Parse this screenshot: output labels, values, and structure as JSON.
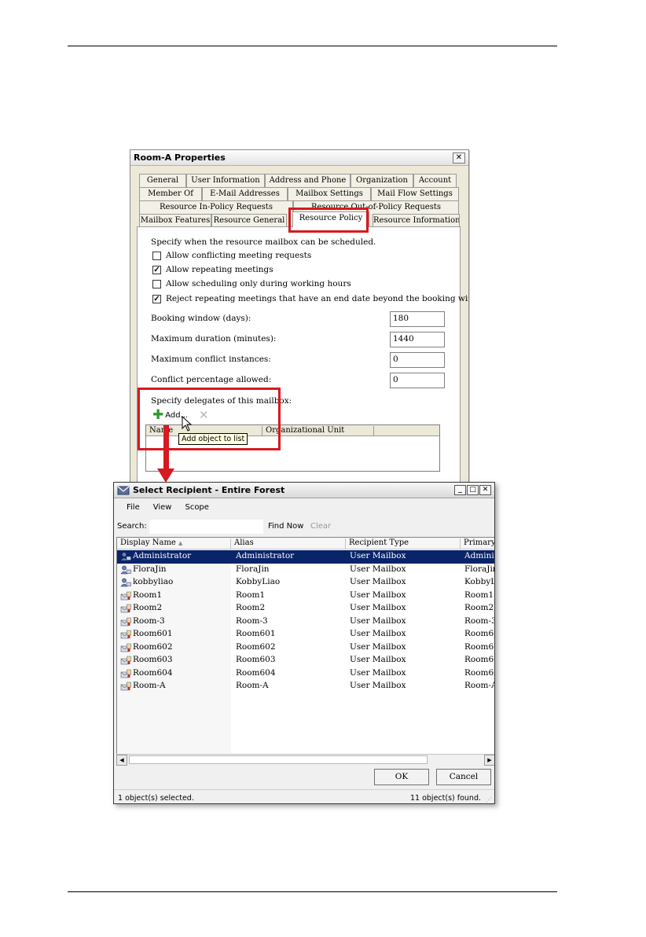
{
  "props": {
    "title": "Room-A Properties",
    "close": "✕",
    "tabs": {
      "row1": [
        "General",
        "User Information",
        "Address and Phone",
        "Organization",
        "Account"
      ],
      "row2": [
        "Member Of",
        "E-Mail Addresses",
        "Mailbox Settings",
        "Mail Flow Settings"
      ],
      "row3": [
        "Resource In-Policy Requests",
        "Resource Out-of-Policy Requests"
      ],
      "row4": [
        "Mailbox Features",
        "Resource General",
        "Resource Policy",
        "Resource Information"
      ],
      "active": "Resource Policy"
    },
    "schedule_heading": "Specify when the resource mailbox can be scheduled.",
    "checks": [
      {
        "label": "Allow conflicting meeting requests",
        "checked": false,
        "mark": ""
      },
      {
        "label": "Allow repeating meetings",
        "checked": true,
        "mark": "✓"
      },
      {
        "label": "Allow scheduling only during working hours",
        "checked": false,
        "mark": ""
      },
      {
        "label": "Reject repeating meetings that have an end date beyond the booking window",
        "checked": true,
        "mark": "✓"
      }
    ],
    "fields": [
      {
        "label": "Booking window (days):",
        "value": "180"
      },
      {
        "label": "Maximum duration (minutes):",
        "value": "1440"
      },
      {
        "label": "Maximum conflict instances:",
        "value": "0"
      },
      {
        "label": "Conflict percentage allowed:",
        "value": "0"
      }
    ],
    "delegates_heading": "Specify delegates of this mailbox:",
    "add_label": "Add...",
    "remove_icon": "✕",
    "delegate_columns": [
      "Name",
      "Organizational Unit"
    ],
    "tooltip": "Add object to list"
  },
  "select": {
    "title": "Select Recipient - Entire Forest",
    "window_buttons": [
      "_",
      "□",
      "✕"
    ],
    "menu": [
      "File",
      "View",
      "Scope"
    ],
    "search_label": "Search:",
    "search_value": "",
    "find_now": "Find Now",
    "clear": "Clear",
    "columns": [
      "Display Name",
      "Alias",
      "Recipient Type",
      "Primary"
    ],
    "sort_indicator": "▲",
    "rows": [
      {
        "name": "Administrator",
        "alias": "Administrator",
        "type": "User Mailbox",
        "primary": "Adminis",
        "selected": true,
        "icon": "user-icon"
      },
      {
        "name": "FloraJin",
        "alias": "FloraJin",
        "type": "User Mailbox",
        "primary": "FloraJin",
        "selected": false,
        "icon": "user-icon"
      },
      {
        "name": "kobbyliao",
        "alias": "KobbyLiao",
        "type": "User Mailbox",
        "primary": "KobbyL",
        "selected": false,
        "icon": "user-icon"
      },
      {
        "name": "Room1",
        "alias": "Room1",
        "type": "User Mailbox",
        "primary": "Room1(",
        "selected": false,
        "icon": "room-mailbox-icon"
      },
      {
        "name": "Room2",
        "alias": "Room2",
        "type": "User Mailbox",
        "primary": "Room2(",
        "selected": false,
        "icon": "room-mailbox-icon"
      },
      {
        "name": "Room-3",
        "alias": "Room-3",
        "type": "User Mailbox",
        "primary": "Room-3",
        "selected": false,
        "icon": "room-mailbox-icon"
      },
      {
        "name": "Room601",
        "alias": "Room601",
        "type": "User Mailbox",
        "primary": "Room60",
        "selected": false,
        "icon": "room-mailbox-icon"
      },
      {
        "name": "Room602",
        "alias": "Room602",
        "type": "User Mailbox",
        "primary": "Room60",
        "selected": false,
        "icon": "room-mailbox-icon"
      },
      {
        "name": "Room603",
        "alias": "Room603",
        "type": "User Mailbox",
        "primary": "Room60",
        "selected": false,
        "icon": "room-mailbox-icon"
      },
      {
        "name": "Room604",
        "alias": "Room604",
        "type": "User Mailbox",
        "primary": "Room60",
        "selected": false,
        "icon": "room-mailbox-icon"
      },
      {
        "name": "Room-A",
        "alias": "Room-A",
        "type": "User Mailbox",
        "primary": "Room-A",
        "selected": false,
        "icon": "room-mailbox-icon"
      }
    ],
    "scroll_left": "◀",
    "scroll_right": "▶",
    "ok": "OK",
    "cancel": "Cancel",
    "status_left": "1 object(s) selected.",
    "status_right": "11 object(s) found."
  },
  "colors": {
    "highlight": "#d71920",
    "selection": "#0a246a"
  }
}
